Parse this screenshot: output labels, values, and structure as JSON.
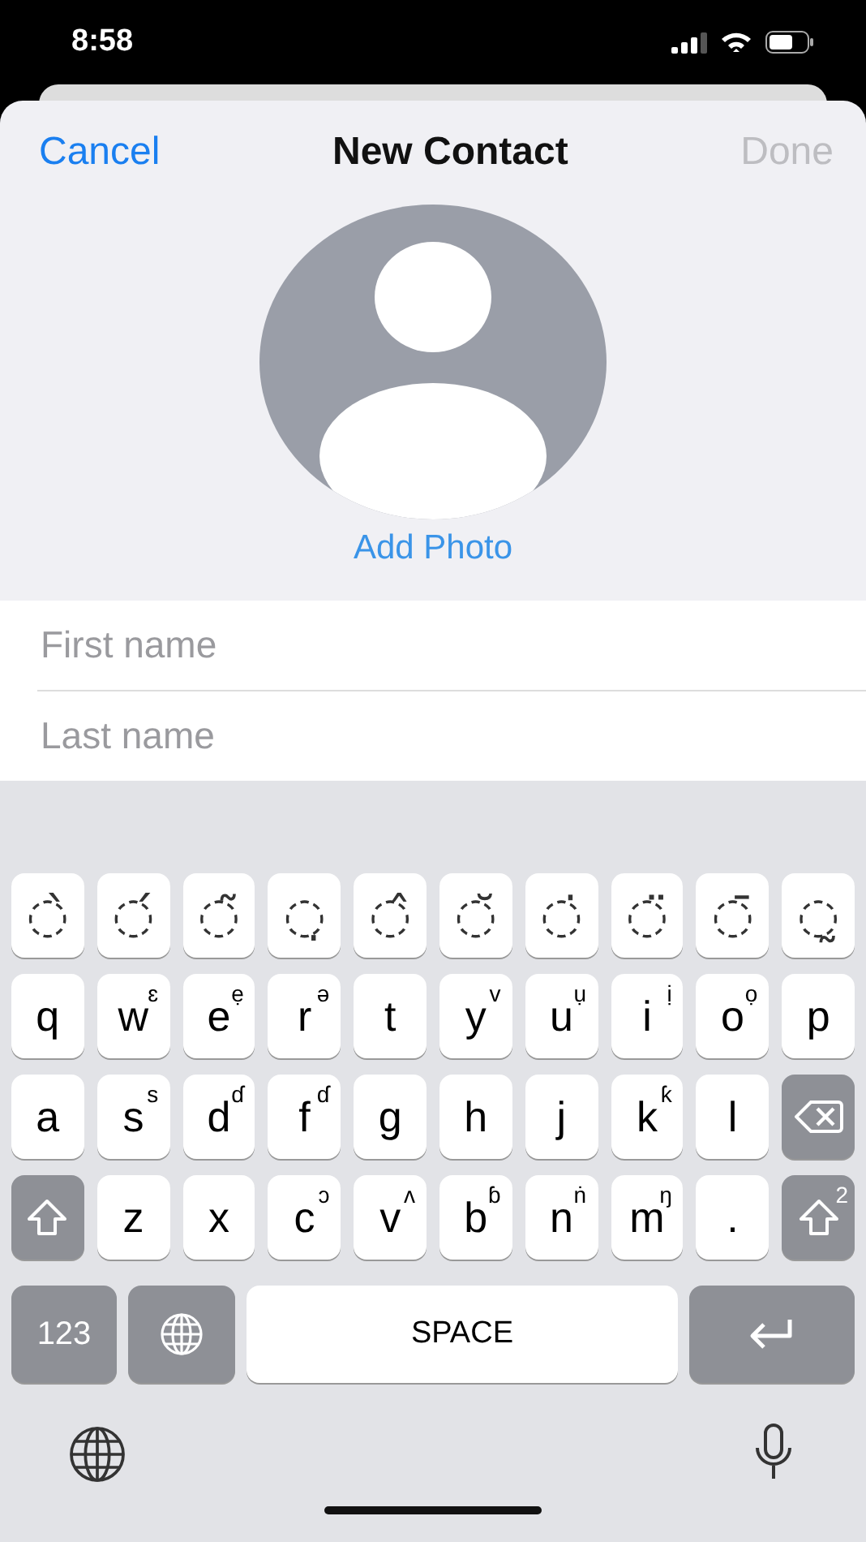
{
  "status_bar": {
    "time": "8:58"
  },
  "nav": {
    "cancel": "Cancel",
    "title": "New Contact",
    "done": {
      "label": "Done",
      "disabled": true
    }
  },
  "photo": {
    "link": "Add Photo"
  },
  "fields": [
    {
      "placeholder": "First name"
    },
    {
      "placeholder": "Last name"
    }
  ],
  "keyboard": {
    "rows": [
      [
        {
          "kind": "letter",
          "label": "◌̀"
        },
        {
          "kind": "letter",
          "label": "◌́"
        },
        {
          "kind": "letter",
          "label": "◌̃"
        },
        {
          "kind": "letter",
          "label": "◌̣"
        },
        {
          "kind": "letter",
          "label": "◌̂"
        },
        {
          "kind": "letter",
          "label": "◌̆"
        },
        {
          "kind": "letter",
          "label": "◌̇"
        },
        {
          "kind": "letter",
          "label": "◌̈"
        },
        {
          "kind": "letter",
          "label": "◌̄"
        },
        {
          "kind": "letter",
          "label": "◌̰"
        }
      ],
      [
        {
          "kind": "letter",
          "label": "q"
        },
        {
          "kind": "letter",
          "label": "w",
          "sup": "ɛ"
        },
        {
          "kind": "letter",
          "label": "e",
          "sup": "ẹ"
        },
        {
          "kind": "letter",
          "label": "r",
          "sup": "ə"
        },
        {
          "kind": "letter",
          "label": "t"
        },
        {
          "kind": "letter",
          "label": "y",
          "sup": "ᴠ"
        },
        {
          "kind": "letter",
          "label": "u",
          "sup": "ụ"
        },
        {
          "kind": "letter",
          "label": "i",
          "sup": "ị"
        },
        {
          "kind": "letter",
          "label": "o",
          "sup": "ọ"
        },
        {
          "kind": "letter",
          "label": "p"
        }
      ],
      [
        {
          "kind": "letter",
          "label": "a"
        },
        {
          "kind": "letter",
          "label": "s",
          "sup": "s"
        },
        {
          "kind": "letter",
          "label": "d",
          "sup": "ɗ"
        },
        {
          "kind": "letter",
          "label": "f",
          "sup": "ɗ"
        },
        {
          "kind": "letter",
          "label": "g"
        },
        {
          "kind": "letter",
          "label": "h"
        },
        {
          "kind": "letter",
          "label": "j"
        },
        {
          "kind": "letter",
          "label": "k",
          "sup": "ƙ"
        },
        {
          "kind": "letter",
          "label": "l"
        },
        {
          "kind": "backspace"
        }
      ],
      [
        {
          "kind": "shift"
        },
        {
          "kind": "letter",
          "label": "z"
        },
        {
          "kind": "letter",
          "label": "x"
        },
        {
          "kind": "letter",
          "label": "c",
          "sup": "ɔ"
        },
        {
          "kind": "letter",
          "label": "v",
          "sup": "ʌ"
        },
        {
          "kind": "letter",
          "label": "b",
          "sup": "ɓ"
        },
        {
          "kind": "letter",
          "label": "n",
          "sup": "ṅ"
        },
        {
          "kind": "letter",
          "label": "m",
          "sup": "ŋ"
        },
        {
          "kind": "letter",
          "label": "."
        },
        {
          "kind": "shift",
          "sup": "2"
        }
      ]
    ],
    "bottom": [
      {
        "kind": "numbers",
        "label": "123"
      },
      {
        "kind": "globe"
      },
      {
        "kind": "space",
        "label": "SPACE"
      },
      {
        "kind": "return"
      }
    ]
  }
}
